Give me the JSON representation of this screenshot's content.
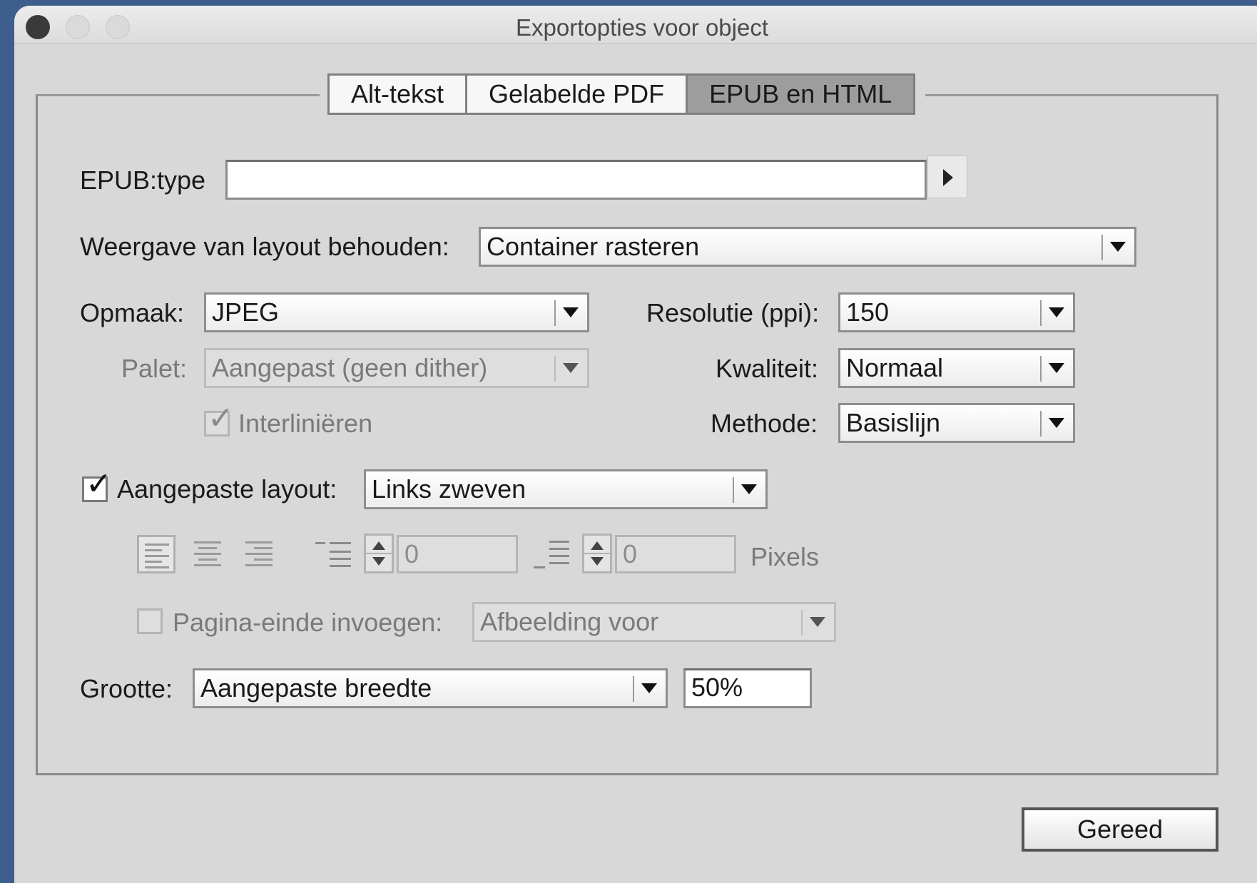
{
  "window": {
    "title": "Exportopties voor object"
  },
  "tabs": [
    {
      "label": "Alt-tekst",
      "active": false
    },
    {
      "label": "Gelabelde PDF",
      "active": false
    },
    {
      "label": "EPUB en HTML",
      "active": true
    }
  ],
  "epub_type": {
    "label": "EPUB:type",
    "value": ""
  },
  "layout_preserve": {
    "label": "Weergave van layout behouden:",
    "value": "Container rasteren"
  },
  "format": {
    "label": "Opmaak:",
    "value": "JPEG"
  },
  "palette": {
    "label": "Palet:",
    "value": "Aangepast (geen dither)",
    "enabled": false
  },
  "interlace": {
    "label": "Interliniëren",
    "checked": true,
    "enabled": false
  },
  "resolution": {
    "label": "Resolutie (ppi):",
    "value": "150"
  },
  "quality": {
    "label": "Kwaliteit:",
    "value": "Normaal"
  },
  "method": {
    "label": "Methode:",
    "value": "Basislijn"
  },
  "custom_layout": {
    "label": "Aangepaste layout:",
    "checked": true,
    "value": "Links zweven"
  },
  "spacing": {
    "before_value": "0",
    "after_value": "0",
    "unit_label": "Pixels"
  },
  "page_break": {
    "label": "Pagina-einde invoegen:",
    "checked": false,
    "value": "Afbeelding voor"
  },
  "size": {
    "label": "Grootte:",
    "value": "Aangepaste breedte",
    "percent": "50%"
  },
  "done_button": {
    "label": "Gereed"
  }
}
